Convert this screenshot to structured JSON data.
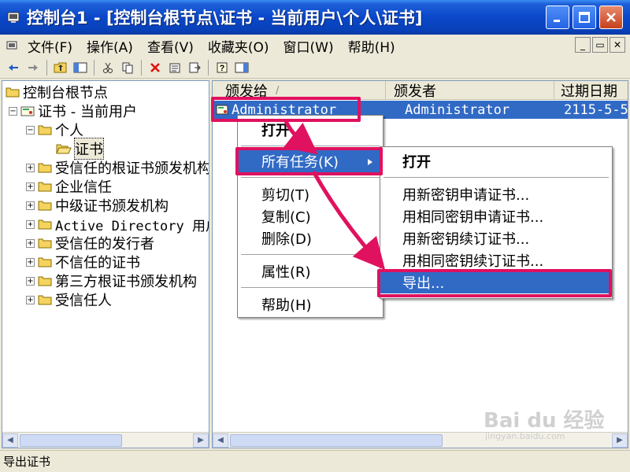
{
  "window": {
    "title": "控制台1 - [控制台根节点\\证书 - 当前用户\\个人\\证书]"
  },
  "menubar": {
    "items": [
      "文件(F)",
      "操作(A)",
      "查看(V)",
      "收藏夹(O)",
      "窗口(W)",
      "帮助(H)"
    ]
  },
  "tree": {
    "items": [
      {
        "label": "控制台根节点"
      },
      {
        "label": "证书 - 当前用户",
        "expander": "−"
      },
      {
        "label": "个人",
        "expander": "−"
      },
      {
        "label": "证书"
      },
      {
        "label": "受信任的根证书颁发机构",
        "expander": "+"
      },
      {
        "label": "企业信任",
        "expander": "+"
      },
      {
        "label": "中级证书颁发机构",
        "expander": "+"
      },
      {
        "label": "Active Directory 用户对象",
        "expander": "+"
      },
      {
        "label": "受信任的发行者",
        "expander": "+"
      },
      {
        "label": "不信任的证书",
        "expander": "+"
      },
      {
        "label": "第三方根证书颁发机构",
        "expander": "+"
      },
      {
        "label": "受信任人",
        "expander": "+"
      }
    ]
  },
  "list": {
    "columns": [
      "颁发给",
      "颁发者",
      "过期日期"
    ],
    "sort_indicator": "/",
    "rows": [
      {
        "issued_to": "Administrator",
        "issued_by": "Administrator",
        "expires": "2115-5-5"
      }
    ]
  },
  "context_menu": {
    "items": [
      "打开",
      "所有任务(K)",
      "剪切(T)",
      "复制(C)",
      "删除(D)",
      "属性(R)",
      "帮助(H)"
    ]
  },
  "submenu": {
    "items": [
      "打开",
      "用新密钥申请证书...",
      "用相同密钥申请证书...",
      "用新密钥续订证书...",
      "用相同密钥续订证书...",
      "导出..."
    ]
  },
  "statusbar": {
    "text": "导出证书"
  },
  "watermark": {
    "text": "Bai du 经验",
    "sub": "jingyan.baidu.com"
  },
  "colors": {
    "selection": "#316ac5",
    "highlight_box": "#e0115f"
  }
}
